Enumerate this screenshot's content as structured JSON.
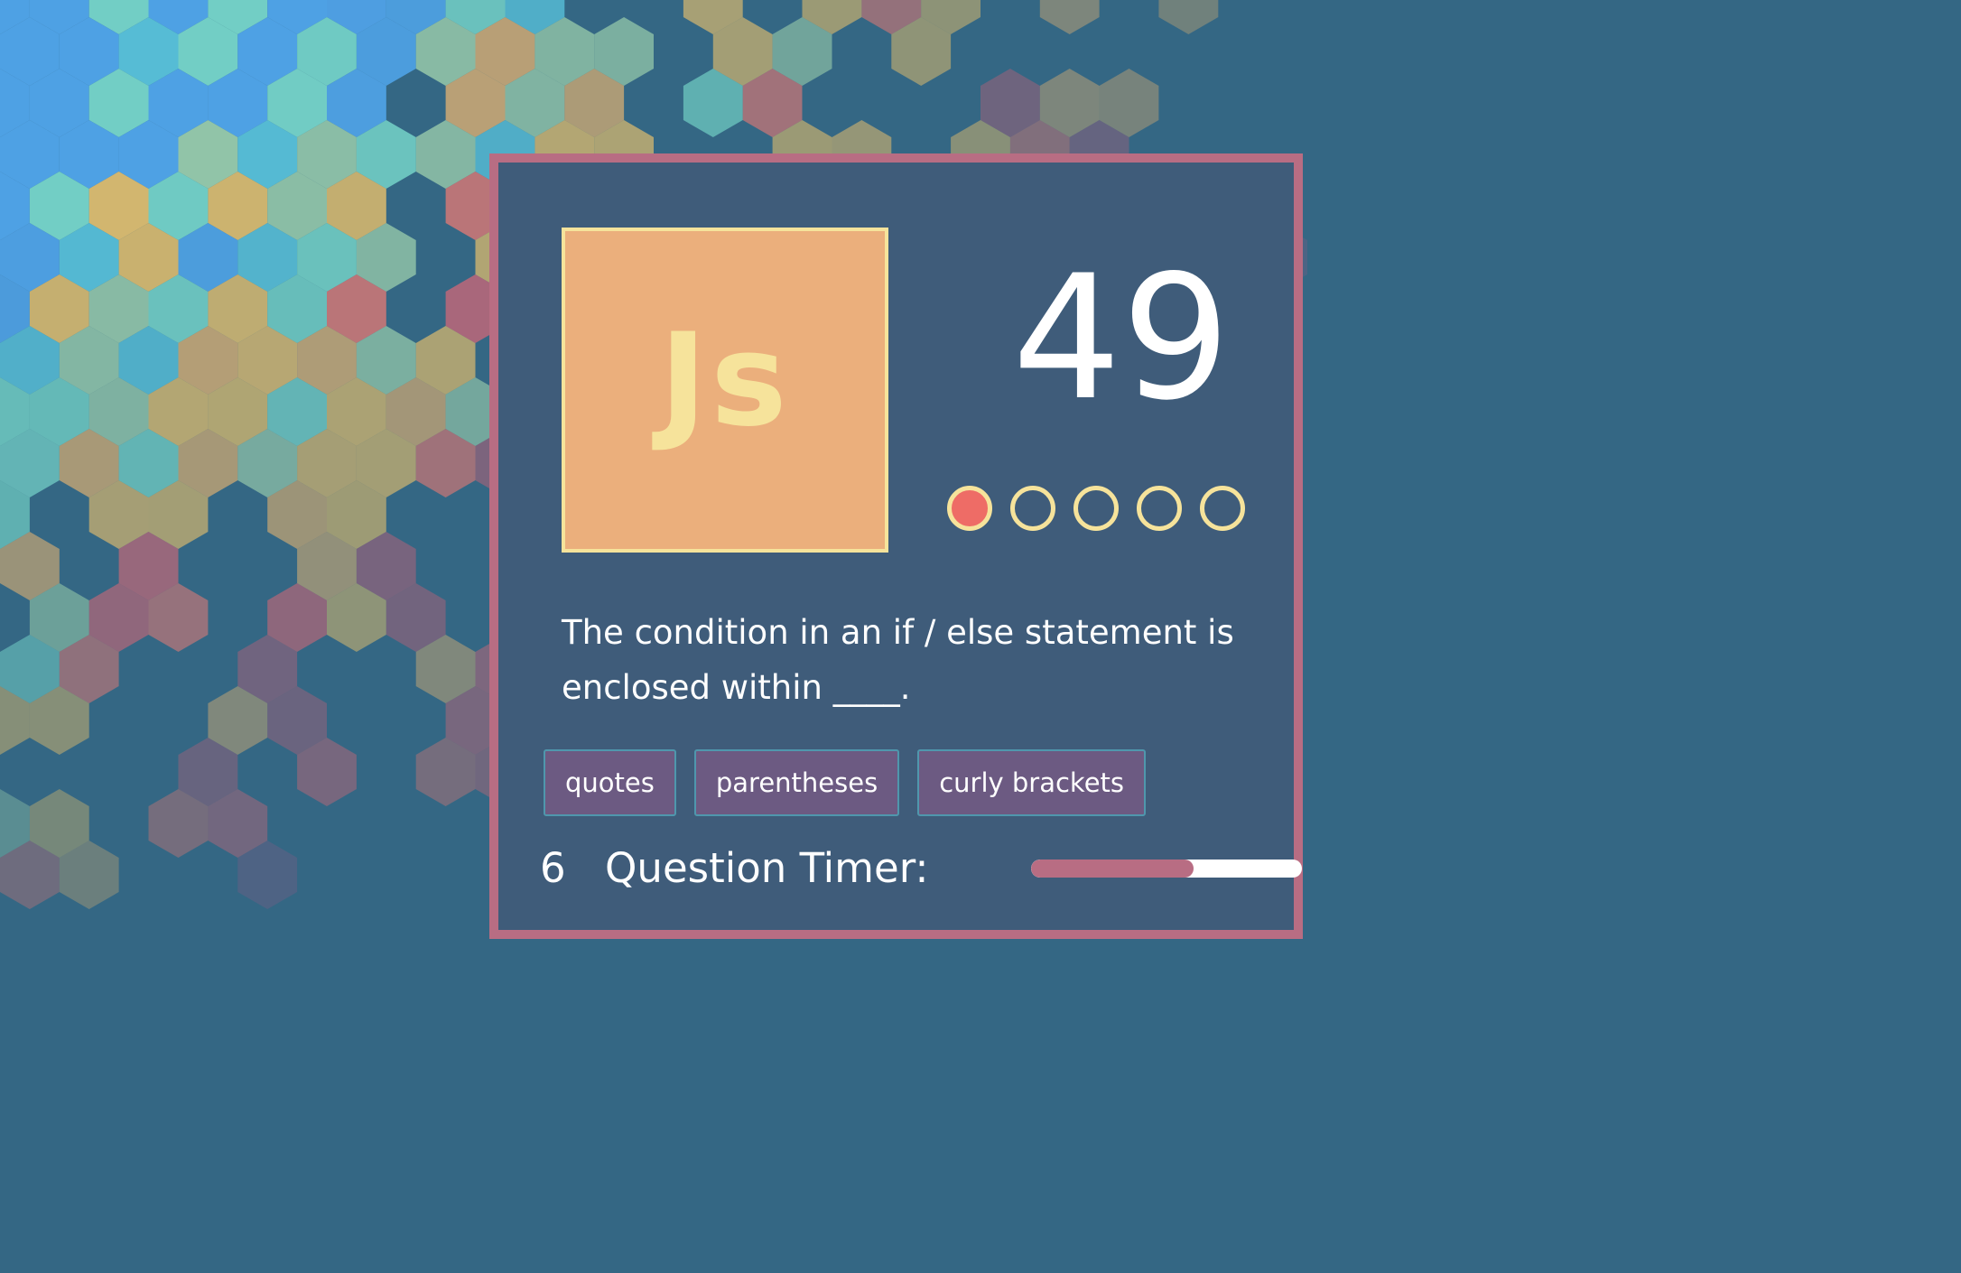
{
  "logo": {
    "text": "Js"
  },
  "score": "49",
  "progress": {
    "total": 5,
    "current": 1
  },
  "question": {
    "text": "The condition in an if / else statement is enclosed within ____."
  },
  "answers": [
    {
      "label": "quotes"
    },
    {
      "label": "parentheses"
    },
    {
      "label": "curly brackets"
    }
  ],
  "timer": {
    "count": "6",
    "label": "Question Timer:",
    "fraction_remaining": 0.6
  },
  "colors": {
    "background": "#356784",
    "card_background": "#3f5c7a",
    "card_border": "#b86d83",
    "logo_background": "#ebaf7c",
    "logo_text": "#f6e39b",
    "dot_outline": "#f6e39b",
    "dot_filled": "#ee6c66",
    "answer_button": "#6c5a82",
    "timer_fill": "#b86d83"
  },
  "background_hex_palette": [
    "#53a9f2",
    "#5cc8e1",
    "#7bdcce",
    "#9fd1ae",
    "#ecc26c",
    "#e5b372",
    "#ef7b74",
    "#e56877",
    "#b6627a",
    "#8d5c84",
    "#6a5c8c",
    "#574f82",
    "#3f6a8a"
  ]
}
